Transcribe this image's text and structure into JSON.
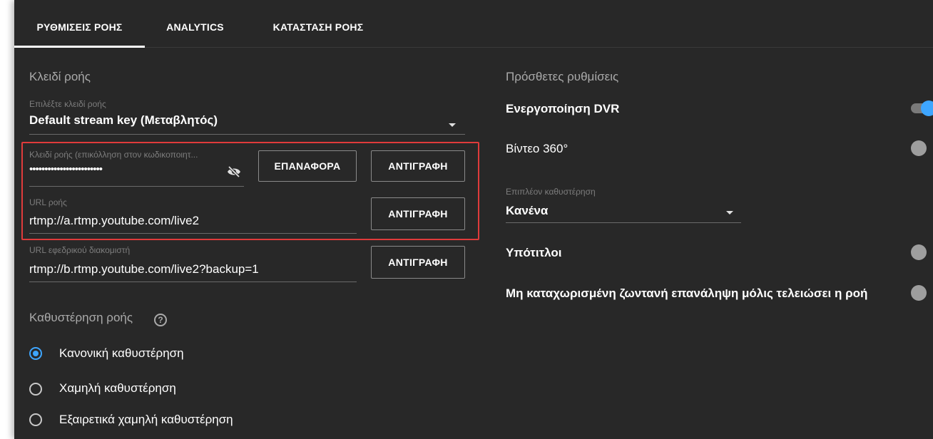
{
  "tabs": [
    {
      "label": "ΡΥΘΜΙΣΕΙΣ ΡΟΗΣ",
      "active": true
    },
    {
      "label": "ANALYTICS",
      "active": false
    },
    {
      "label": "ΚΑΤΑΣΤΑΣΗ ΡΟΗΣ",
      "active": false
    }
  ],
  "stream_key_section": {
    "title": "Κλειδί ροής",
    "select_label": "Επιλέξτε κλειδί ροής",
    "select_value": "Default stream key (Μεταβλητός)",
    "key_label": "Κλειδί ροής (επικόλληση στον κωδικοποιητ...",
    "key_value": "••••••••••••••••••••••••",
    "reset_button": "ΕΠΑΝΑΦΟΡΑ",
    "copy_button": "ΑΝΤΙΓΡΑΦΗ",
    "url_label": "URL ροής",
    "url_value": "rtmp://a.rtmp.youtube.com/live2",
    "backup_label": "URL εφεδρικού διακομιστή",
    "backup_value": "rtmp://b.rtmp.youtube.com/live2?backup=1"
  },
  "latency_section": {
    "title": "Καθυστέρηση ροής",
    "help_icon": "?",
    "options": [
      {
        "label": "Κανονική καθυστέρηση",
        "selected": true
      },
      {
        "label": "Χαμηλή καθυστέρηση",
        "selected": false
      },
      {
        "label": "Εξαιρετικά χαμηλή καθυστέρηση",
        "selected": false
      }
    ]
  },
  "additional_settings": {
    "title": "Πρόσθετες ρυθμίσεις",
    "dvr_label": "Ενεργοποίηση DVR",
    "dvr_on": true,
    "video360_label": "Βίντεο 360°",
    "video360_on": false,
    "delay_label": "Επιπλέον καθυστέρηση",
    "delay_value": "Κανένα",
    "subtitles_label": "Υπότιτλοι",
    "subtitles_on": false,
    "unlisted_label": "Μη καταχωρισμένη ζωντανή επανάληψη μόλις τελειώσει η ροή",
    "unlisted_on": false
  },
  "colors": {
    "background": "#282828",
    "accent": "#3ea6ff",
    "highlight_box": "#e03b3b"
  }
}
